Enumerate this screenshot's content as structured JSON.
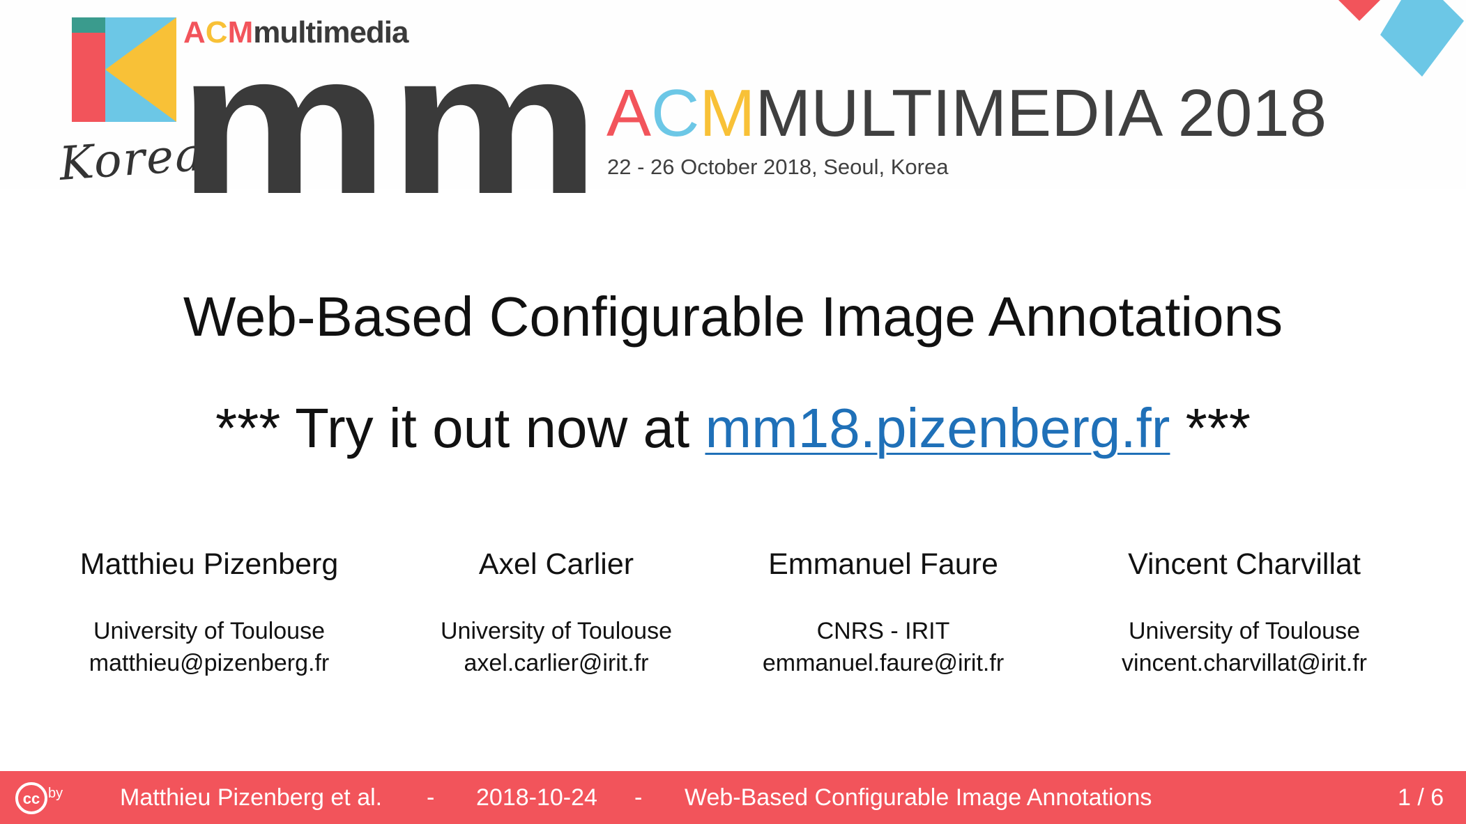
{
  "header": {
    "korea_script": "Korea",
    "acm_small_letters": [
      "A",
      "C",
      "M"
    ],
    "acm_small_word": "multimedia",
    "mm_text": "mm",
    "conference_name_parts": [
      "A",
      "C",
      "M",
      "MULTIMEDIA 2018"
    ],
    "conference_dates": "22 - 26 October 2018, Seoul, Korea",
    "colors": {
      "red": "#f2545b",
      "blue": "#6cc7e6",
      "yellow": "#f8c137",
      "dark": "#3a3a3a"
    }
  },
  "slide": {
    "title": "Web-Based Configurable Image Annotations",
    "try_prefix": "*** Try it out now at ",
    "try_link": "mm18.pizenberg.fr",
    "try_suffix": " ***",
    "link_color": "#1f70b8"
  },
  "authors": [
    {
      "name": "Matthieu Pizenberg",
      "affiliation": "University of Toulouse",
      "email": "matthieu@pizenberg.fr"
    },
    {
      "name": "Axel Carlier",
      "affiliation": "University of Toulouse",
      "email": "axel.carlier@irit.fr"
    },
    {
      "name": "Emmanuel Faure",
      "affiliation": "CNRS - IRIT",
      "email": "emmanuel.faure@irit.fr"
    },
    {
      "name": "Vincent Charvillat",
      "affiliation": "University of Toulouse",
      "email": "vincent.charvillat@irit.fr"
    }
  ],
  "footer": {
    "license_cc": "cc",
    "license_by": "by",
    "author": "Matthieu Pizenberg et al.",
    "sep1": "-",
    "date": "2018-10-24",
    "sep2": "-",
    "title": "Web-Based Configurable Image Annotations",
    "page": "1 / 6",
    "background": "#f2545b"
  }
}
